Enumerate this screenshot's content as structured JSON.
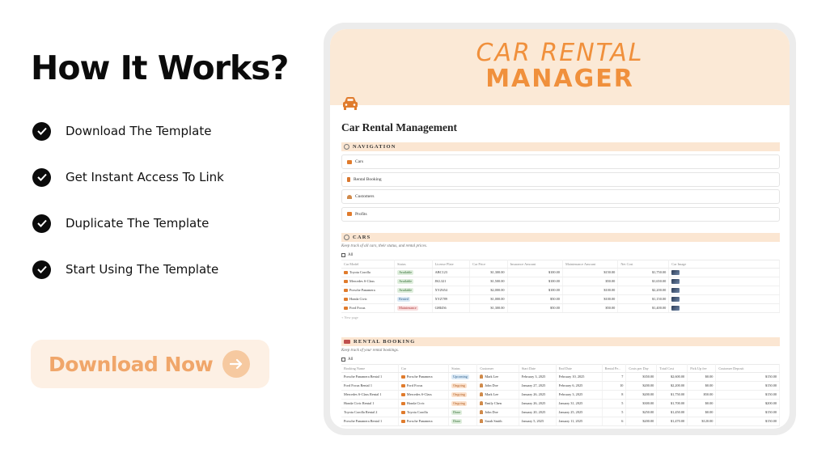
{
  "headline": "How It Works?",
  "steps": [
    "Download The Template",
    "Get Instant Access To Link",
    "Duplicate The Template",
    "Start Using The Template"
  ],
  "download_label": "Download Now",
  "banner": {
    "line1": "CAR RENTAL",
    "line2": "MANAGER"
  },
  "page_title": "Car Rental Management",
  "navigation": {
    "title": "NAVIGATION",
    "items": [
      {
        "label": "Cars",
        "icon": "car-icon",
        "color": "#e07b2c"
      },
      {
        "label": "Rental Booking",
        "icon": "bookmark-icon",
        "color": "#d9772e"
      },
      {
        "label": "Customers",
        "icon": "people-icon",
        "color": "#d08a4a"
      },
      {
        "label": "Profits",
        "icon": "money-icon",
        "color": "#e07b2c"
      }
    ]
  },
  "cars": {
    "title": "CARS",
    "subtitle": "Keep track of all cars, their status, and rental prices.",
    "view": "All",
    "columns": [
      "Car Model",
      "Status",
      "License Plate",
      "Car Price",
      "Insurance Amount",
      "Maintenance Amount",
      "Net Cost",
      "Car Image"
    ],
    "rows": [
      {
        "model": "Toyota Corolla",
        "status": "Available",
        "plate": "ABC123",
        "price": "$1,300.00",
        "insurance": "$100.00",
        "maintenance": "$150.00",
        "net": "$1,750.00"
      },
      {
        "model": "Mercedes S-Class",
        "status": "Available",
        "plate": "JKL321",
        "price": "$1,500.00",
        "insurance": "$100.00",
        "maintenance": "$50.00",
        "net": "$1,650.00"
      },
      {
        "model": "Porsche Panamera",
        "status": "Available",
        "plate": "XYZ654",
        "price": "$2,000.00",
        "insurance": "$100.00",
        "maintenance": "$100.00",
        "net": "$2,200.00"
      },
      {
        "model": "Honda Civic",
        "status": "Rented",
        "plate": "XYZ789",
        "price": "$1,000.00",
        "insurance": "$50.00",
        "maintenance": "$100.00",
        "net": "$1,150.00"
      },
      {
        "model": "Ford Focus",
        "status": "Maintenance",
        "plate": "GHI456",
        "price": "$1,300.00",
        "insurance": "$50.00",
        "maintenance": "$50.00",
        "net": "$1,400.00"
      }
    ],
    "new_page": "+ New page"
  },
  "rental_booking": {
    "title": "RENTAL BOOKING",
    "subtitle": "Keep track of your rental bookings.",
    "view": "All",
    "columns": [
      "Booking Name",
      "Car",
      "Status",
      "Customer",
      "Start Date",
      "End Date",
      "Rental Pe...",
      "Costs per Day",
      "Total Cost",
      "Pick Up fee",
      "Customer Deposit"
    ],
    "rows": [
      {
        "name": "Porsche Panamera Rental 1",
        "car": "Porsche Panamera",
        "status": "Upcoming",
        "customer": "Mark Lee",
        "start": "February 3, 2025",
        "end": "February 10, 2025",
        "period": "7",
        "cpd": "$350.00",
        "total": "$2,600.00",
        "pickup": "$0.00",
        "deposit": "$150.00"
      },
      {
        "name": "Ford Focus Rental 1",
        "car": "Ford Focus",
        "status": "Ongoing",
        "customer": "John Doe",
        "start": "January 27, 2025",
        "end": "February 6, 2025",
        "period": "10",
        "cpd": "$200.00",
        "total": "$2,200.00",
        "pickup": "$0.00",
        "deposit": "$150.00"
      },
      {
        "name": "Mercedes S-Class Rental 1",
        "car": "Mercedes S-Class",
        "status": "Ongoing",
        "customer": "Mark Lee",
        "start": "January 26, 2025",
        "end": "February 3, 2025",
        "period": "8",
        "cpd": "$200.00",
        "total": "$1,750.00",
        "pickup": "$50.00",
        "deposit": "$150.00"
      },
      {
        "name": "Honda Civic Rental 1",
        "car": "Honda Civic",
        "status": "Ongoing",
        "customer": "Emily Chen",
        "start": "January 26, 2025",
        "end": "January 31, 2025",
        "period": "5",
        "cpd": "$300.00",
        "total": "$1,700.00",
        "pickup": "$0.00",
        "deposit": "$200.00"
      },
      {
        "name": "Toyota Corolla Rental 2",
        "car": "Toyota Corolla",
        "status": "Done",
        "customer": "John Doe",
        "start": "January 20, 2025",
        "end": "January 25, 2025",
        "period": "5",
        "cpd": "$250.00",
        "total": "$1,450.00",
        "pickup": "$0.00",
        "deposit": "$150.00"
      },
      {
        "name": "Porsche Panamera Rental 1",
        "car": "Porsche Panamera",
        "status": "Done",
        "customer": "Sarah Smith",
        "start": "January 5, 2025",
        "end": "January 11, 2025",
        "period": "6",
        "cpd": "$200.00",
        "total": "$1,470.00",
        "pickup": "$120.00",
        "deposit": "$150.00"
      }
    ]
  },
  "colors": {
    "accent": "#f0903c",
    "banner_bg": "#fbe9d6",
    "button_bg": "#fdf0e4",
    "button_text": "#f0a66a"
  }
}
